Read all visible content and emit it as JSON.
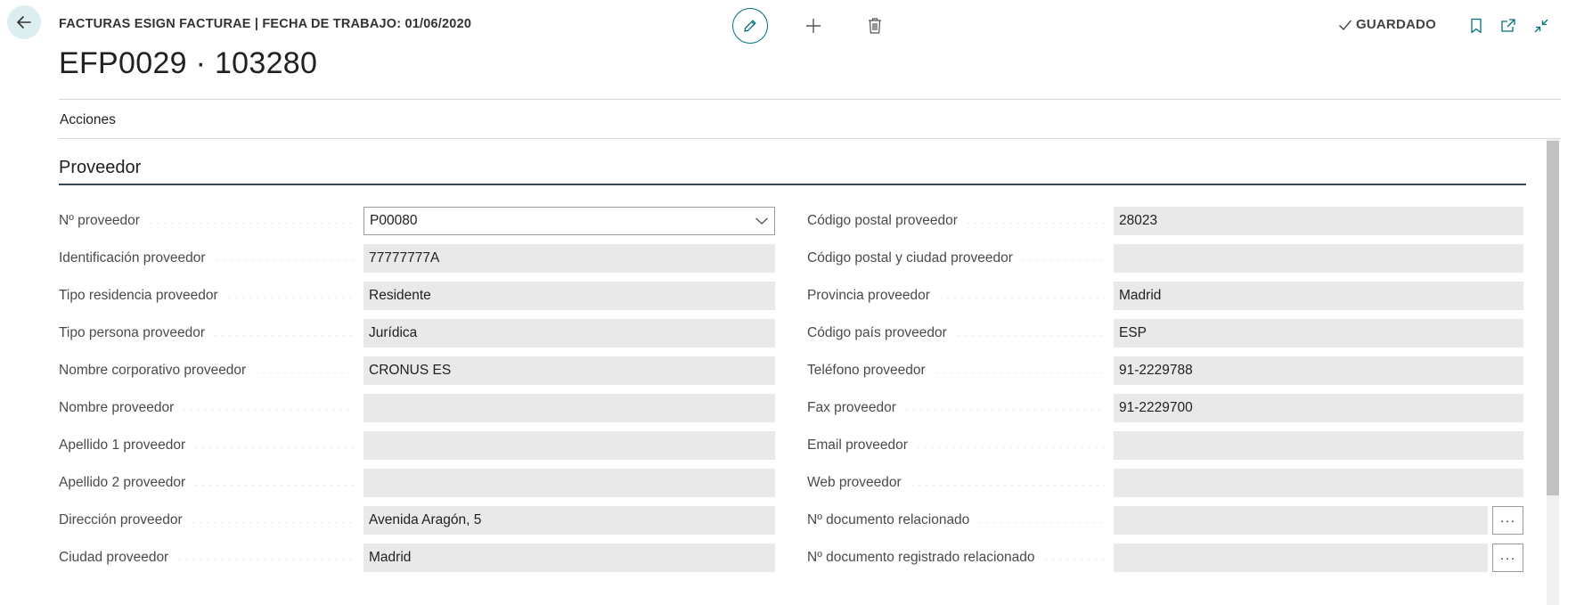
{
  "header": {
    "caption": "FACTURAS ESIGN FACTURAE | FECHA DE TRABAJO: 01/06/2020",
    "record_title": "EFP0029 · 103280",
    "saved_status": "GUARDADO"
  },
  "action_bar": {
    "actions_label": "Acciones"
  },
  "section": {
    "title": "Proveedor"
  },
  "fields_left": [
    {
      "label": "Nº proveedor",
      "value": "P00080",
      "type": "dropdown"
    },
    {
      "label": "Identificación proveedor",
      "value": "77777777A"
    },
    {
      "label": "Tipo residencia proveedor",
      "value": "Residente"
    },
    {
      "label": "Tipo persona proveedor",
      "value": "Jurídica"
    },
    {
      "label": "Nombre corporativo proveedor",
      "value": "CRONUS ES"
    },
    {
      "label": "Nombre proveedor",
      "value": ""
    },
    {
      "label": "Apellido 1 proveedor",
      "value": ""
    },
    {
      "label": "Apellido 2 proveedor",
      "value": ""
    },
    {
      "label": "Dirección proveedor",
      "value": "Avenida Aragón, 5"
    },
    {
      "label": "Ciudad proveedor",
      "value": "Madrid"
    }
  ],
  "fields_right": [
    {
      "label": "Código postal proveedor",
      "value": "28023"
    },
    {
      "label": "Código postal y ciudad proveedor",
      "value": ""
    },
    {
      "label": "Provincia proveedor",
      "value": "Madrid"
    },
    {
      "label": "Código país proveedor",
      "value": "ESP"
    },
    {
      "label": "Teléfono proveedor",
      "value": "91-2229788"
    },
    {
      "label": "Fax proveedor",
      "value": "91-2229700"
    },
    {
      "label": "Email proveedor",
      "value": ""
    },
    {
      "label": "Web proveedor",
      "value": ""
    },
    {
      "label": "Nº documento relacionado",
      "value": "",
      "lookup": "···"
    },
    {
      "label": "Nº documento registrado relacionado",
      "value": "",
      "lookup": "···"
    }
  ],
  "colors": {
    "accent": "#00707a",
    "field_bg": "#e9e9e9",
    "back_button_bg": "#ddeef0"
  },
  "icons": {
    "back": "arrow-left-icon",
    "edit": "pencil-icon",
    "new": "plus-icon",
    "delete": "trash-icon",
    "saved": "checkmark-icon",
    "bookmark": "bookmark-icon",
    "open_new_window": "open-in-new-window-icon",
    "collapse": "collapse-icon",
    "dropdown": "chevron-down-icon"
  }
}
